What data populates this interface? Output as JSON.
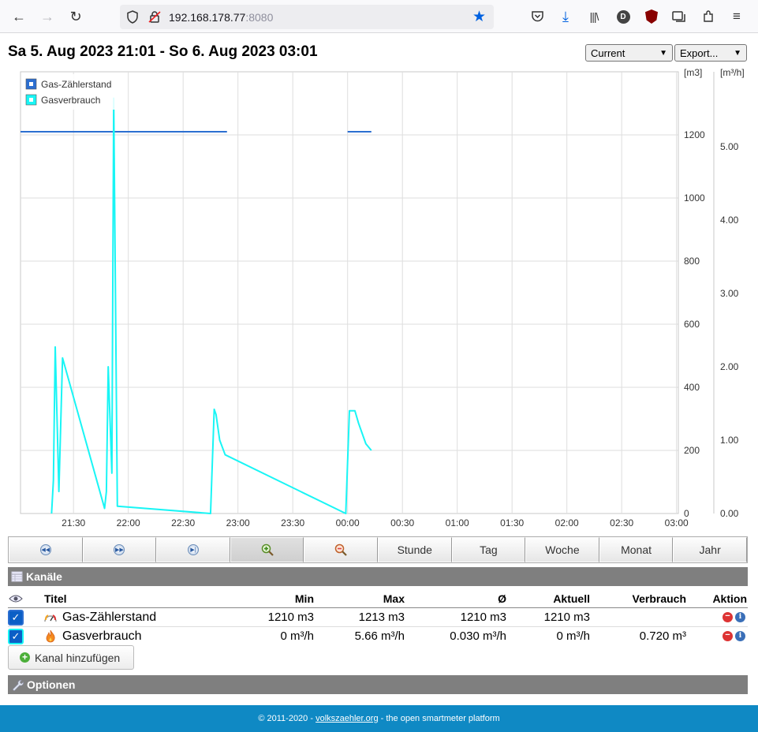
{
  "browser": {
    "url_host": "192.168.178.77",
    "url_port": ":8080",
    "account_initial": "D"
  },
  "header": {
    "title": "Sa 5. Aug 2023 21:01 - So 6. Aug 2023 03:01",
    "mode_select": "Current",
    "export_select": "Export..."
  },
  "chart_data": {
    "type": "line",
    "x_ticks": [
      "21:30",
      "22:00",
      "22:30",
      "23:00",
      "23:30",
      "00:00",
      "00:30",
      "01:00",
      "01:30",
      "02:00",
      "02:30",
      "03:00"
    ],
    "y_left": {
      "unit": "[m3]",
      "ticks": [
        0,
        200,
        400,
        600,
        800,
        1000,
        1200
      ],
      "range": [
        0,
        1400
      ]
    },
    "y_right": {
      "unit": "[m³/h]",
      "ticks": [
        "0.00",
        "1.00",
        "2.00",
        "3.00",
        "4.00",
        "5.00"
      ],
      "range": [
        0,
        6.02
      ]
    },
    "legend": [
      "Gas-Zählerstand",
      "Gasverbrauch"
    ],
    "series": [
      {
        "name": "Gas-Zählerstand",
        "color": "#2c6fd1",
        "axis": "left",
        "segments": [
          [
            [
              "21:01",
              1210
            ],
            [
              "22:54",
              1210
            ]
          ],
          [
            [
              "00:00",
              1210
            ],
            [
              "00:13",
              1210
            ]
          ]
        ]
      },
      {
        "name": "Gasverbrauch",
        "color": "#19f5f5",
        "axis": "right",
        "points": [
          [
            "21:18",
            0.0
          ],
          [
            "21:19",
            0.45
          ],
          [
            "21:20",
            2.27
          ],
          [
            "21:22",
            0.3
          ],
          [
            "21:24",
            2.12
          ],
          [
            "21:47",
            0.07
          ],
          [
            "21:48",
            0.3
          ],
          [
            "21:49",
            2.0
          ],
          [
            "21:51",
            0.55
          ],
          [
            "21:52",
            5.66
          ],
          [
            "21:54",
            0.1
          ],
          [
            "22:45",
            0.0
          ],
          [
            "22:47",
            1.42
          ],
          [
            "22:48",
            1.35
          ],
          [
            "22:50",
            1.0
          ],
          [
            "22:53",
            0.8
          ],
          [
            "23:59",
            0.0
          ],
          [
            "00:01",
            1.4
          ],
          [
            "00:04",
            1.4
          ],
          [
            "00:06",
            1.23
          ],
          [
            "00:10",
            0.95
          ],
          [
            "00:13",
            0.86
          ]
        ]
      }
    ]
  },
  "nav_buttons": {
    "back": "◀◀",
    "forward": "▶▶",
    "end": "▶|",
    "stunde": "Stunde",
    "tag": "Tag",
    "woche": "Woche",
    "monat": "Monat",
    "jahr": "Jahr"
  },
  "channels": {
    "section_title": "Kanäle",
    "headers": {
      "titel": "Titel",
      "min": "Min",
      "max": "Max",
      "avg": "Ø",
      "aktuell": "Aktuell",
      "verbrauch": "Verbrauch",
      "aktion": "Aktion"
    },
    "rows": [
      {
        "title": "Gas-Zählerstand",
        "min": "1210 m3",
        "max": "1213 m3",
        "avg": "1210 m3",
        "aktuell": "1210 m3",
        "verbrauch": "",
        "color": "#2c6fd1"
      },
      {
        "title": "Gasverbrauch",
        "min": "0 m³/h",
        "max": "5.66 m³/h",
        "avg": "0.030 m³/h",
        "aktuell": "0 m³/h",
        "verbrauch": "0.720 m³",
        "color": "#19f5f5"
      }
    ],
    "add_button": "Kanal hinzufügen"
  },
  "options": {
    "section_title": "Optionen"
  },
  "footer": {
    "prefix": "© 2011-2020 - ",
    "link": "volkszaehler.org",
    "suffix": " - the open smartmeter platform"
  }
}
